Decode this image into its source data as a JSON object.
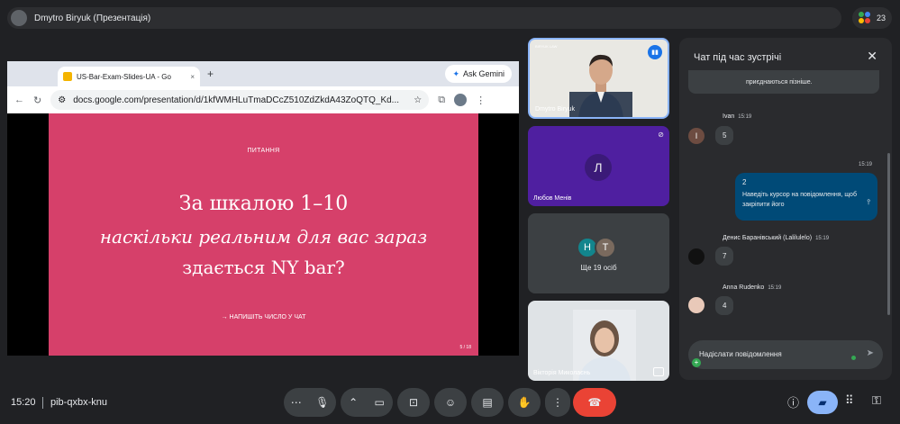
{
  "topbar": {
    "title": "Dmytro Biryuk (Презентація)",
    "participants_count": "23"
  },
  "browser": {
    "tab_title": "US-Bar-Exam-Slides-UA - Go",
    "tab_close": "×",
    "new_tab": "+",
    "gemini_label": "Ask Gemini",
    "url": "docs.google.com/presentation/d/1kfWMHLuTmaDCcZ510ZdZkdA43ZoQTQ_Kd..."
  },
  "slide": {
    "kicker": "ПИТАННЯ",
    "line1": "За шкалою 1–10",
    "line2": "наскільки реальним для вас зараз",
    "line3": "здається NY bar?",
    "cta": "→ НАПИШІТЬ ЧИСЛО У ЧАТ",
    "page": "5 / 18"
  },
  "tiles": {
    "speaker": "Dmytro Biryuk",
    "speaker_logo": "BIRYUK LAW",
    "tile2_name": "Любов Менів",
    "tile2_initial": "Л",
    "group_initials": [
      "Н",
      "Т"
    ],
    "group_label": "Ще 19 осіб",
    "tile4_name": "Вікторія Миколаєнь"
  },
  "chat": {
    "header": "Чат під час зустрічі",
    "system_message": "приєднаються пізніше.",
    "messages": [
      {
        "sender": "Ivan",
        "time": "15:19",
        "text": "5",
        "initial": "I"
      },
      {
        "sender": "Денис Баранівський (Lalilulelo)",
        "time": "15:19",
        "text": "7"
      },
      {
        "sender": "Anna Rudenko",
        "time": "15:19",
        "text": "4"
      }
    ],
    "own_time": "15:19",
    "own_text": "2",
    "own_hint": "Наведіть курсор на повідомлення, щоб закріпити його",
    "input_placeholder": "Надіслати повідомлення"
  },
  "bottombar": {
    "time": "15:20",
    "meeting_code": "pib-qxbx-knu"
  },
  "colors": {
    "slide_bg": "#d6406a",
    "end_call": "#ea4335",
    "own_bubble": "#004a77",
    "tile2_bg": "#4f1fa0",
    "active_chat": "#8ab4f8"
  }
}
